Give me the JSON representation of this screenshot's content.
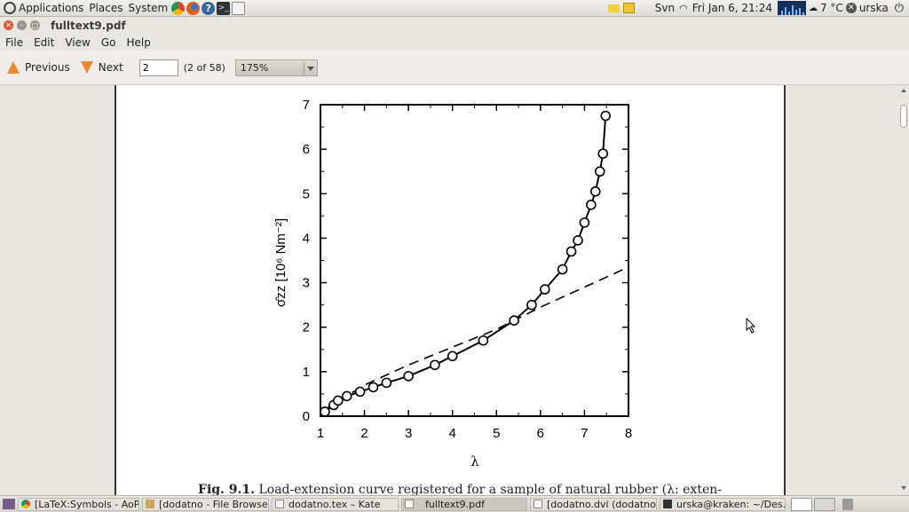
{
  "top_panel": {
    "menus": [
      "Applications",
      "Places",
      "System"
    ],
    "launchers": [
      "chrome-icon",
      "firefox-icon",
      "help-icon",
      "terminal-icon",
      "text-editor-icon"
    ],
    "keyboard_layout": "Svn",
    "datetime": "Fri Jan  6, 21:24",
    "temperature": "7 °C",
    "user": "urska"
  },
  "window": {
    "title": "fulltext9.pdf"
  },
  "menu_bar": [
    "File",
    "Edit",
    "View",
    "Go",
    "Help"
  ],
  "toolbar": {
    "previous_label": "Previous",
    "next_label": "Next",
    "page_value": "2",
    "page_count": "(2 of 58)",
    "zoom_value": "175%"
  },
  "chart_data": {
    "type": "line",
    "xlabel": "λ",
    "ylabel": "σ̂zz [10⁶ Nm⁻²]",
    "xlim": [
      1,
      8
    ],
    "ylim": [
      0,
      7
    ],
    "xticks": [
      "1",
      "2",
      "3",
      "4",
      "5",
      "6",
      "7",
      "8"
    ],
    "yticks": [
      "0",
      "1",
      "2",
      "3",
      "4",
      "5",
      "6",
      "7"
    ],
    "series": [
      {
        "style": "solid-with-circles",
        "x": [
          1.1,
          1.3,
          1.4,
          1.6,
          1.9,
          2.2,
          2.5,
          3.0,
          3.6,
          4.0,
          4.7,
          5.4,
          5.8,
          6.1,
          6.5,
          6.7,
          6.85,
          7.0,
          7.15,
          7.25,
          7.35,
          7.42,
          7.48
        ],
        "y": [
          0.1,
          0.25,
          0.35,
          0.45,
          0.55,
          0.65,
          0.75,
          0.9,
          1.15,
          1.35,
          1.7,
          2.15,
          2.5,
          2.85,
          3.3,
          3.7,
          3.95,
          4.35,
          4.75,
          5.05,
          5.5,
          5.9,
          6.75
        ]
      },
      {
        "style": "dashed",
        "x": [
          1.1,
          2.0,
          3.0,
          4.0,
          5.0,
          6.0,
          7.0,
          8.0
        ],
        "y": [
          0.15,
          0.7,
          1.15,
          1.55,
          1.95,
          2.45,
          2.9,
          3.35
        ]
      }
    ]
  },
  "caption": {
    "label": "Fig. 9.1.",
    "text": "Load-extension curve registered for a sample of natural rubber (λ: exten-"
  },
  "taskbar": [
    "[LaTeX:Symbols - AoP...",
    "[dodatno - File Browser]",
    "dodatno.tex – Kate",
    "fulltext9.pdf",
    "[dodatno.dvi (dodatno...",
    "urska@kraken: ~/Des..."
  ],
  "colors": {
    "accent": "#f28a2c",
    "panel": "#e9e7e2"
  }
}
